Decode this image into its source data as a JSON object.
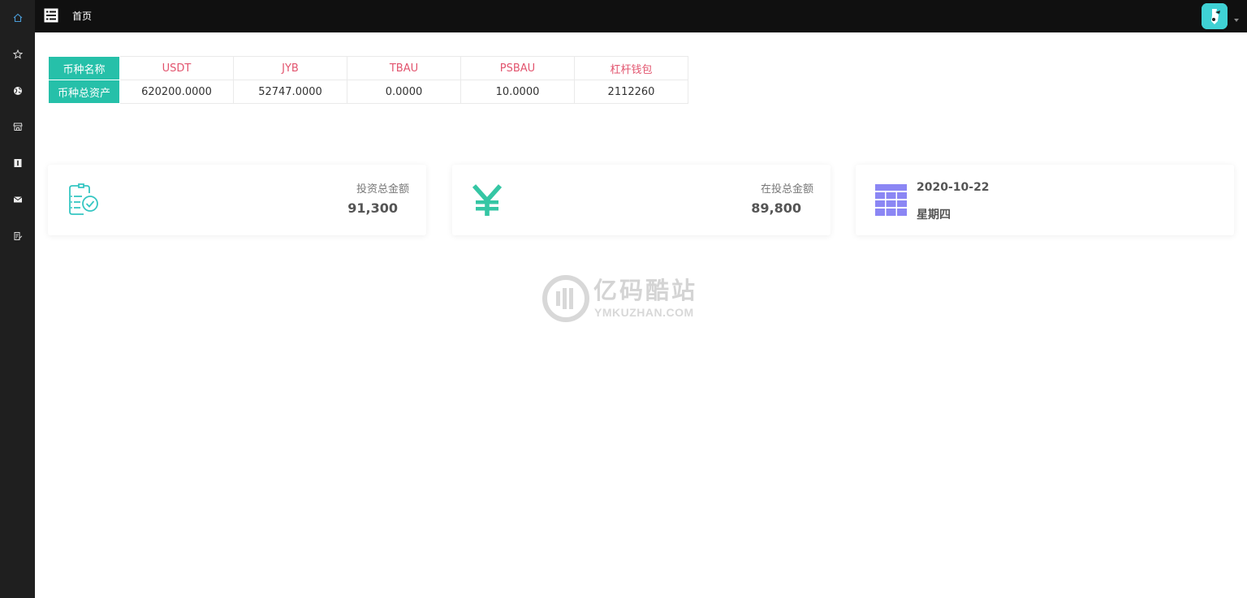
{
  "topbar": {
    "page_title": "首页"
  },
  "sidebar": {
    "items": [
      {
        "icon": "home-icon"
      },
      {
        "icon": "star-icon"
      },
      {
        "icon": "globe-icon"
      },
      {
        "icon": "store-icon"
      },
      {
        "icon": "info-icon"
      },
      {
        "icon": "mail-icon"
      },
      {
        "icon": "edit-doc-icon"
      }
    ]
  },
  "assets_table": {
    "row_headers": [
      "币种名称",
      "币种总资产"
    ],
    "coins": [
      "USDT",
      "JYB",
      "TBAU",
      "PSBAU",
      "杠杆钱包"
    ],
    "totals": [
      "620200.0000",
      "52747.0000",
      "0.0000",
      "10.0000",
      "2112260"
    ]
  },
  "cards": {
    "investment_total": {
      "label": "投资总金额",
      "value": "91,300"
    },
    "investing_total": {
      "label": "在投总金额",
      "value": "89,800"
    },
    "date": {
      "date": "2020-10-22",
      "weekday": "星期四"
    }
  },
  "watermark": {
    "title": "亿码酷站",
    "subtitle": "YMKUZHAN.COM"
  },
  "colors": {
    "sidebar_bg": "#1f1f1f",
    "topbar_bg": "#101010",
    "accent_teal": "#26c0a9",
    "coin_red": "#e2546e",
    "calendar_purple": "#8b86f4",
    "avatar_bg": "#3fd1d4"
  }
}
